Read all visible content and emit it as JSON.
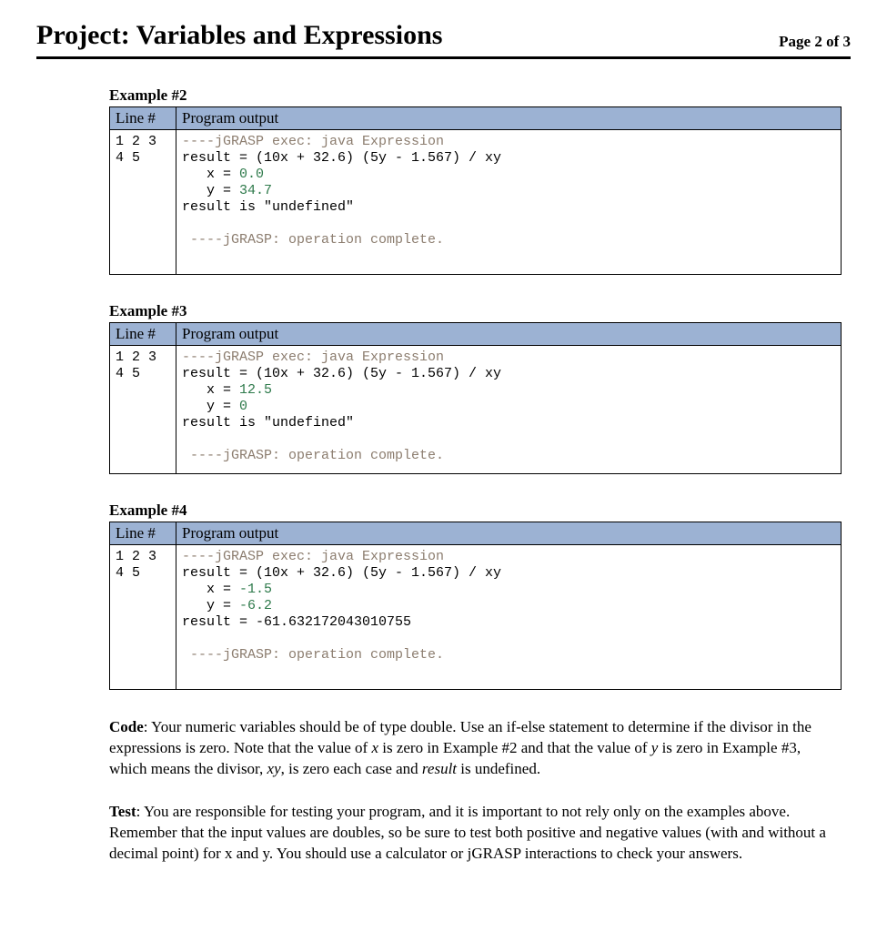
{
  "header": {
    "title": "Project: Variables and Expressions",
    "page_label": "Page 2 of 3"
  },
  "column_headers": {
    "line": "Line #",
    "output": "Program output"
  },
  "examples": [
    {
      "heading": "Example #2",
      "linenos": "\n1\n2\n3\n4\n5",
      "out_exec_prefix": "----",
      "out_exec_text": "jGRASP exec: java Expression",
      "out_result_expr": "result = (10x + 32.6) (5y - 1.567) / xy",
      "out_x_label": "   x = ",
      "out_x_val": "0.0",
      "out_y_label": "   y = ",
      "out_y_val": "34.7",
      "out_result_line": "result is \"undefined\"",
      "out_blank": " ",
      "out_done_prefix": " ----",
      "out_done_text": "jGRASP: operation complete.",
      "out_trailing": " "
    },
    {
      "heading": "Example #3",
      "linenos": "\n1\n2\n3\n4\n5",
      "out_exec_prefix": "----",
      "out_exec_text": "jGRASP exec: java Expression",
      "out_result_expr": "result = (10x + 32.6) (5y - 1.567) / xy",
      "out_x_label": "   x = ",
      "out_x_val": "12.5",
      "out_y_label": "   y = ",
      "out_y_val": "0",
      "out_result_line": "result is \"undefined\"",
      "out_blank": " ",
      "out_done_prefix": " ----",
      "out_done_text": "jGRASP: operation complete."
    },
    {
      "heading": "Example #4",
      "linenos": "\n1\n2\n3\n4\n5",
      "out_exec_prefix": "----",
      "out_exec_text": "jGRASP exec: java Expression",
      "out_result_expr": "result = (10x + 32.6) (5y - 1.567) / xy",
      "out_x_label": "   x = ",
      "out_x_val": "-1.5",
      "out_y_label": "   y = ",
      "out_y_val": "-6.2",
      "out_result_line": "result = -61.632172043010755",
      "out_blank": " ",
      "out_done_prefix": " ----",
      "out_done_text": "jGRASP: operation complete.",
      "out_trailing": " "
    }
  ],
  "para_code": {
    "label": "Code",
    "sep": ": ",
    "t1": "Your numeric variables should be of type double.  Use an if-else statement to determine if the divisor in the expressions is zero. Note that the value of ",
    "x": "x",
    "t2": " is zero in Example #2 and that the value of ",
    "y": "y",
    "t3": " is zero in Example #3, which means the divisor, ",
    "xy": "xy",
    "t4": ", is zero each case and ",
    "result": "result",
    "t5": " is undefined."
  },
  "para_test": {
    "label": "Test",
    "sep": ": ",
    "text": "You are responsible for testing your program, and it is important to not rely only on the examples above. Remember that the input values are doubles, so be sure to test both positive and negative values (with and without a decimal point) for x and y.  You should use a calculator or jGRASP interactions to check your answers."
  }
}
